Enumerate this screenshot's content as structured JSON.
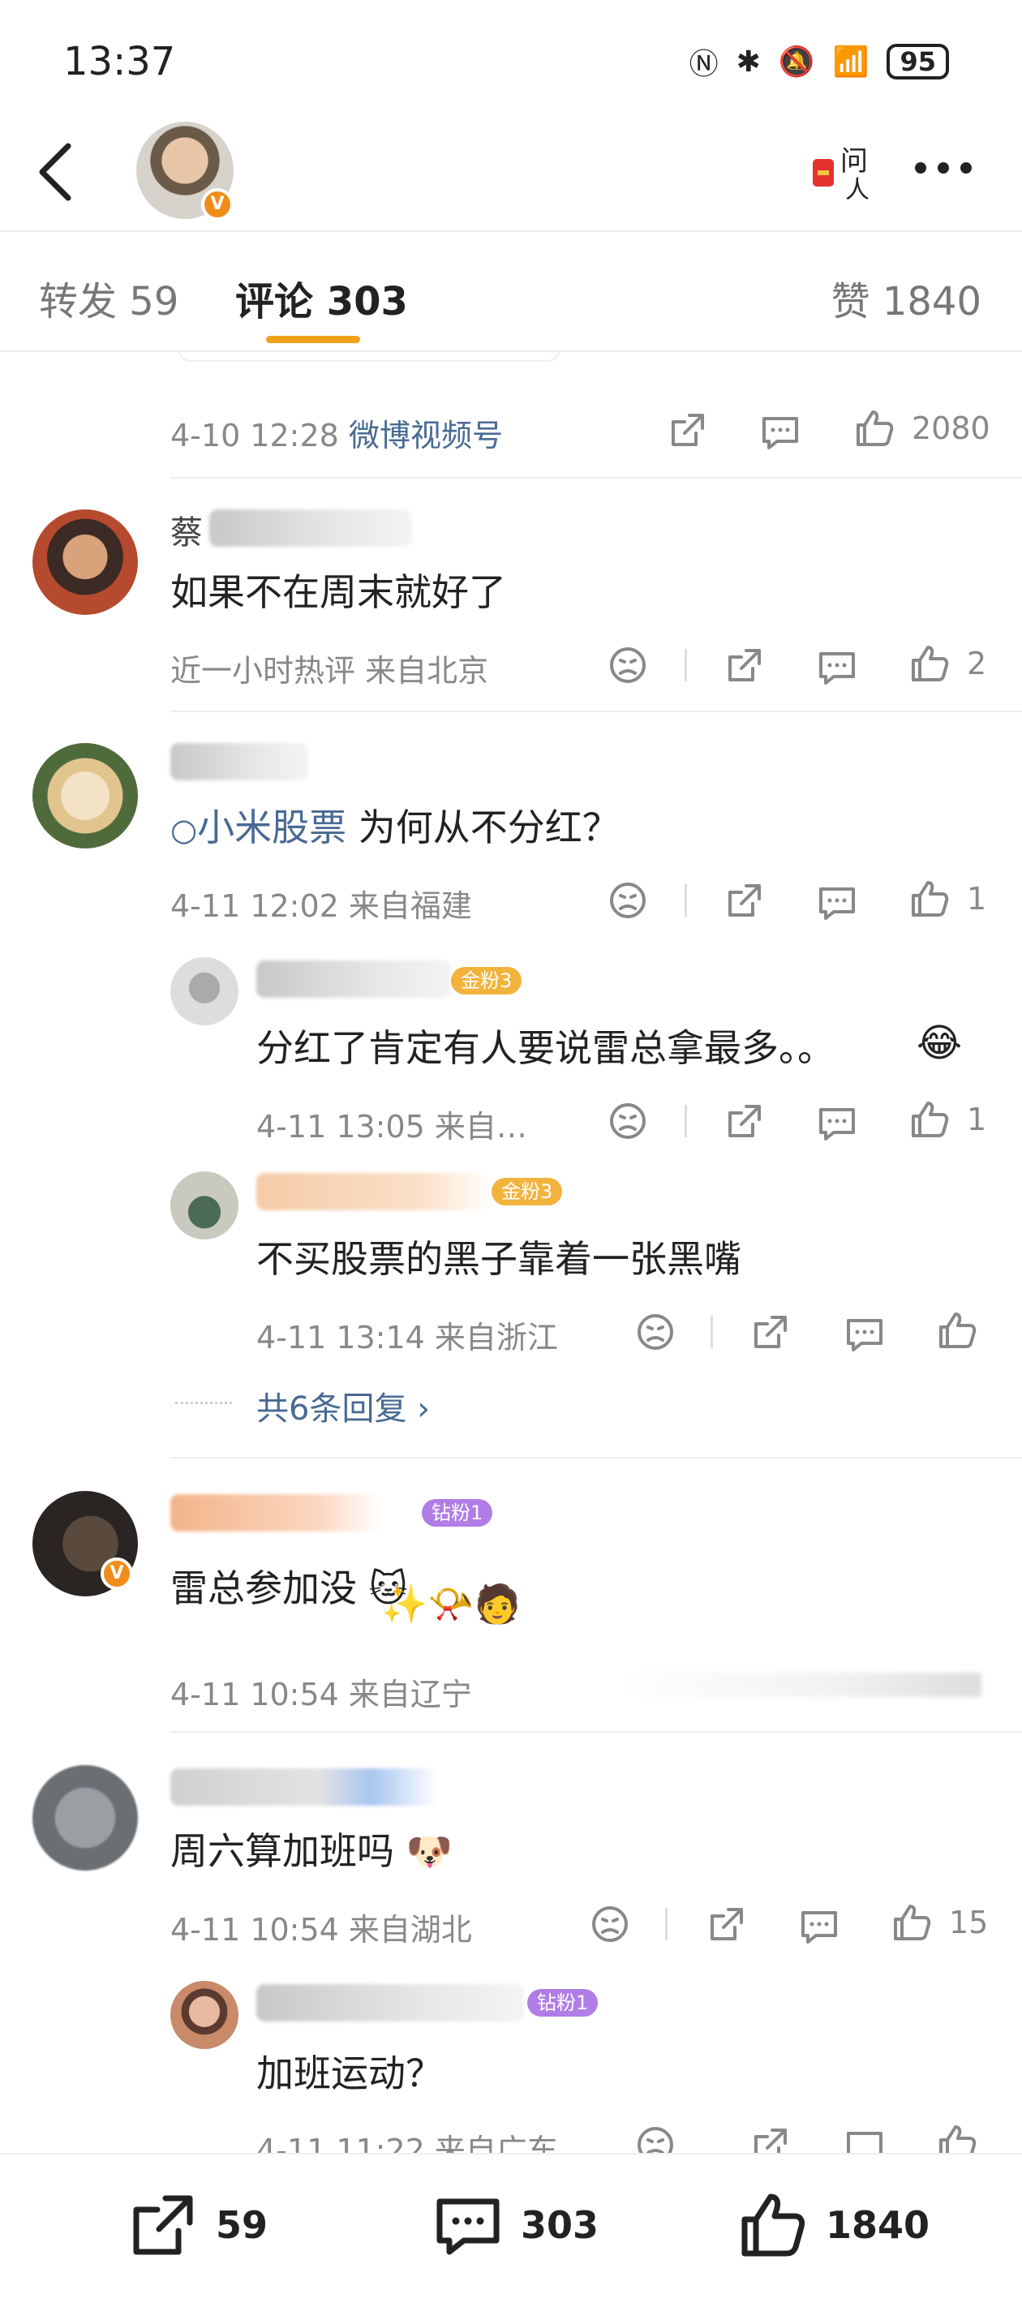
{
  "status_bar": {
    "time": "13:37",
    "battery": "95"
  },
  "tabs": {
    "repost_label": "转发",
    "repost_count": "59",
    "comment_label": "评论",
    "comment_count": "303",
    "like_label": "赞",
    "like_count": "1840"
  },
  "post_meta": {
    "time": "4-10 12:28",
    "source": "微博视频号",
    "likes": "2080"
  },
  "comments": [
    {
      "name_partial": "蔡",
      "text": "如果不在周末就好了",
      "meta": "近一小时热评  来自北京",
      "likes": "2"
    },
    {
      "topic": "小米股票",
      "text": "为何从不分红？",
      "meta": "4-11 12:02  来自福建",
      "likes": "1",
      "replies": [
        {
          "badge": "金粉3",
          "text": "分红了肯定有人要说雷总拿最多。。",
          "meta": "4-11 13:05  来自…",
          "likes": "1"
        },
        {
          "badge": "金粉3",
          "text": "不买股票的黑子靠着一张黑嘴",
          "meta": "4-11 13:14  来自浙江"
        }
      ],
      "more_replies": "共6条回复"
    },
    {
      "badge": "钻粉1",
      "text": "雷总参加没",
      "meta": "4-11 10:54  来自辽宁"
    },
    {
      "text": "周六算加班吗",
      "meta": "4-11 10:54  来自湖北",
      "likes": "15",
      "replies": [
        {
          "badge": "钻粉1",
          "text": "加班运动？",
          "meta": "4-11 11:22  来自广东"
        }
      ]
    }
  ],
  "bottom_bar": {
    "repost": "59",
    "comment": "303",
    "like": "1840"
  },
  "icons": [
    "back-icon",
    "more-icon",
    "question-icon",
    "share-icon",
    "comment-icon",
    "like-icon",
    "dislike-icon"
  ],
  "colors": {
    "accent": "#f0a21c",
    "link": "#486a94",
    "meta": "#888888"
  }
}
